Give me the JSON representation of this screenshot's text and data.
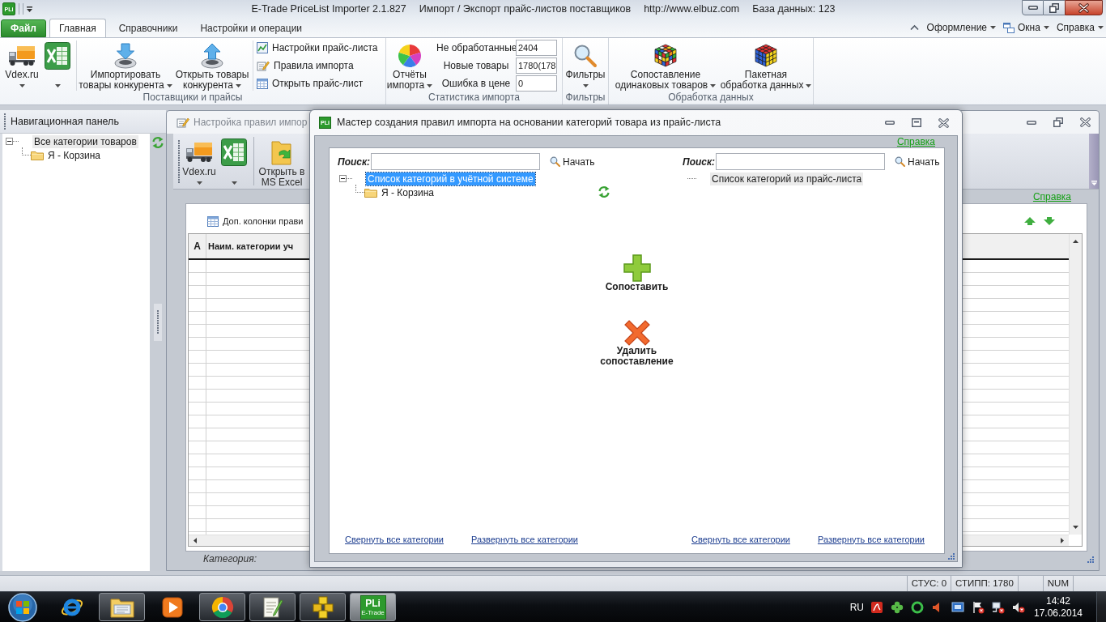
{
  "title_bar": {
    "app_icon_label": "PLi",
    "title_parts": [
      "E-Trade PriceList Importer 2.1.827",
      "Импорт / Экспорт прайс-листов поставщиков",
      "http://www.elbuz.com",
      "База данных: 123"
    ]
  },
  "ribbon_tabs": [
    {
      "label": "Файл",
      "kind": "file",
      "selected": false
    },
    {
      "label": "Главная",
      "kind": "tab",
      "selected": true
    },
    {
      "label": "Справочники",
      "kind": "tab",
      "selected": false
    },
    {
      "label": "Настройки и операции",
      "kind": "tab",
      "selected": false
    }
  ],
  "ribbon_menus": [
    {
      "label": "Оформление",
      "kind": "plain",
      "dropdown": true
    },
    {
      "label": "Окна",
      "kind": "windows",
      "dropdown": true
    },
    {
      "label": "Справка",
      "kind": "plain",
      "dropdown": true
    }
  ],
  "ribbon": {
    "suppliers": {
      "label": "Поставщики и прайсы",
      "vdex": {
        "label": "Vdex.ru",
        "dropdown": true
      },
      "excel": {
        "dropdown": true
      },
      "large_buttons": [
        {
          "lines": [
            "Импортировать",
            "товары конкурента"
          ],
          "dropdown": true
        },
        {
          "lines": [
            "Открыть товары",
            "конкурента"
          ],
          "dropdown": true
        }
      ],
      "small_buttons": [
        "Настройки прайс-листа",
        "Правила импорта",
        "Открыть прайс-лист"
      ]
    },
    "statistics": {
      "label": "Статистика импорта",
      "reports": {
        "lines": [
          "Отчёты",
          "импорта"
        ],
        "dropdown": true
      },
      "stats": [
        {
          "label": "Не обработанные",
          "value": "2404"
        },
        {
          "label": "Новые товары",
          "value": "1780(178"
        },
        {
          "label": "Ошибка в цене",
          "value": "0"
        }
      ]
    },
    "filters": {
      "label": "Фильтры",
      "button": {
        "lines": [
          "Фильтры"
        ],
        "dropdown": true
      }
    },
    "processing": {
      "label": "Обработка данных",
      "buttons": [
        {
          "lines": [
            "Сопоставление",
            "одинаковых товаров"
          ],
          "dropdown": true
        },
        {
          "lines": [
            "Пакетная",
            "обработка данных"
          ],
          "dropdown": true
        }
      ]
    }
  },
  "nav_panel": {
    "title": "Навигационная панель",
    "tree": {
      "focused": false,
      "items": [
        {
          "label": "Все категории товаров",
          "selected": true,
          "expanded": true,
          "children": [
            {
              "label": "Я - Корзина",
              "selected": false
            }
          ]
        }
      ]
    }
  },
  "rules_window": {
    "title": "Настройка правил импор",
    "toolbar": {
      "vdex": {
        "label": "Vdex.ru",
        "dropdown": true
      },
      "excel": {
        "dropdown": true
      },
      "open_excel": {
        "lines": [
          "Открыть в",
          "MS Excel"
        ]
      }
    },
    "help_link": "Справка",
    "columns_button": "Доп. колонки прави",
    "grid": {
      "columns": [
        "А",
        "Наим. категории уч"
      ]
    },
    "footer_label": "Категория:"
  },
  "wizard_dialog": {
    "icon_label": "PLi",
    "title": "Мастер создания правил импорта на основании категорий товара из прайс-листа",
    "help_link": "Справка",
    "panes": [
      {
        "search_label": "Поиск:",
        "search_button": "Начать",
        "tree": {
          "focused": true,
          "items": [
            {
              "label": "Список категорий в учётной системе",
              "selected": true,
              "expanded": true,
              "children": [
                {
                  "label": "Я - Корзина",
                  "selected": false
                }
              ]
            }
          ]
        },
        "links": [
          "Свернуть все категории",
          "Развернуть все категории"
        ]
      },
      {
        "search_label": "Поиск:",
        "search_button": "Начать",
        "tree": {
          "focused": false,
          "items": [
            {
              "label": "Список категорий из прайс-листа",
              "selected": true
            }
          ]
        },
        "links": [
          "Свернуть все категории",
          "Развернуть все категории"
        ]
      }
    ],
    "actions": [
      {
        "kind": "add",
        "lines": [
          "Сопоставить"
        ]
      },
      {
        "kind": "remove",
        "lines": [
          "Удалить",
          "сопоставление"
        ]
      }
    ]
  },
  "status_bar": {
    "items": [
      "СТУС: 0",
      "СТИПП: 1780",
      "NUM"
    ]
  },
  "taskbar": {
    "apps": [
      {
        "running": false,
        "selected": false
      },
      {
        "running": true,
        "selected": false
      },
      {
        "running": false,
        "selected": false
      },
      {
        "running": true,
        "selected": false
      },
      {
        "running": true,
        "selected": false
      },
      {
        "running": true,
        "selected": false
      },
      {
        "running": true,
        "selected": true,
        "icon_label": "PLi",
        "icon_sublabel": "E-Trade"
      }
    ],
    "language": "RU",
    "time": "14:42",
    "date": "17.06.2014"
  }
}
